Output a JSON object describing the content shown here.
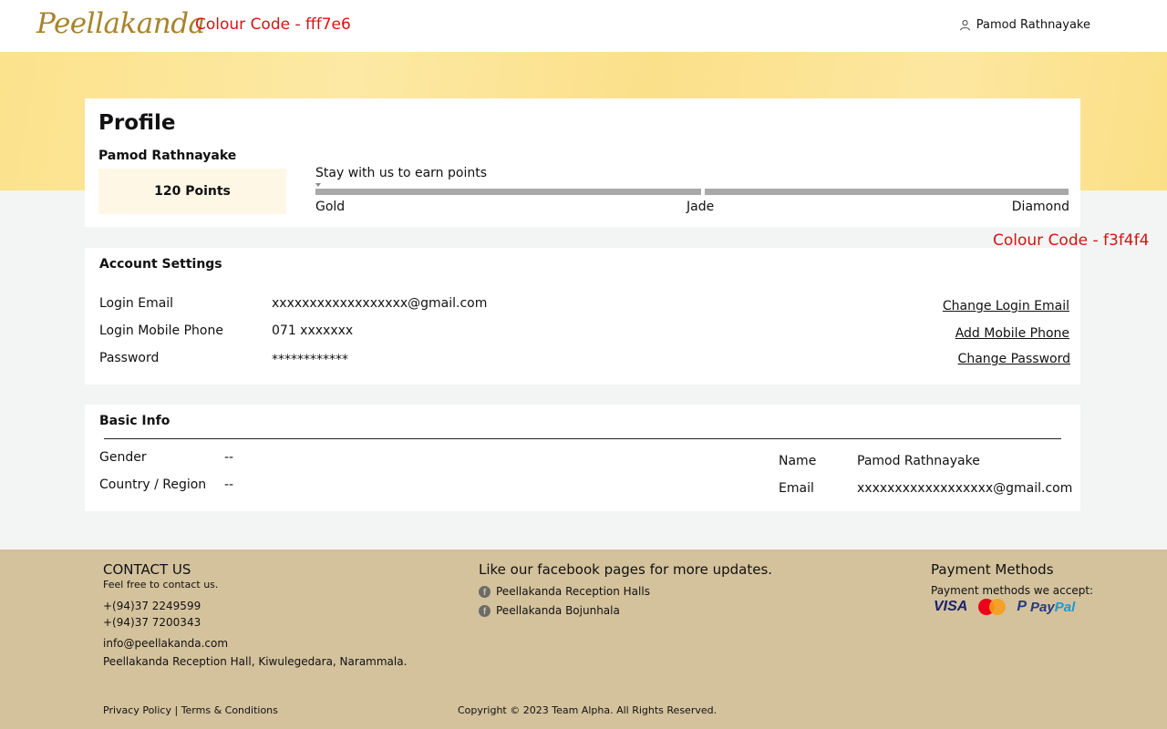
{
  "header": {
    "logo": "Peellakanda",
    "colour_note": "Colour Code - fff7e6",
    "user_name": "Pamod Rathnayake"
  },
  "side_note": "Colour Code - f3f4f4",
  "profile": {
    "title": "Profile",
    "name": "Pamod Rathnayake",
    "points": "120 Points",
    "points_value": 120,
    "earn_label": "Stay with us to earn points",
    "tiers": [
      "Gold",
      "Jade",
      "Diamond"
    ]
  },
  "account_settings": {
    "title": "Account Settings",
    "rows": [
      {
        "label": "Login Email",
        "value": "xxxxxxxxxxxxxxxxxx@gmail.com",
        "action": "Change Login Email"
      },
      {
        "label": "Login Mobile Phone",
        "value": "071 xxxxxxx",
        "action": "Add Mobile Phone"
      },
      {
        "label": "Password",
        "value": "************",
        "action": "Change Password"
      }
    ]
  },
  "basic_info": {
    "title": "Basic Info",
    "left": [
      {
        "label": "Gender",
        "value": "--"
      },
      {
        "label": "Country / Region",
        "value": "--"
      }
    ],
    "right": [
      {
        "label": "Name",
        "value": "Pamod Rathnayake"
      },
      {
        "label": "Email",
        "value": "xxxxxxxxxxxxxxxxxx@gmail.com"
      }
    ]
  },
  "footer": {
    "contact": {
      "heading": "CONTACT US",
      "subtitle": "Feel free to contact us.",
      "phone1": "+(94)37 2249599",
      "phone2": "+(94)37 7200343",
      "email": "info@peellakanda.com",
      "address": "Peellakanda Reception Hall, Kiwulegedara, Narammala."
    },
    "facebook": {
      "heading": "Like our facebook pages for more updates.",
      "pages": [
        "Peellakanda Reception Halls",
        "Peellakanda Bojunhala"
      ]
    },
    "payment": {
      "heading": "Payment Methods",
      "subtitle": "Payment methods we accept:",
      "visa": "VISA",
      "mastercard": "MasterCard",
      "paypal_pay": "Pay",
      "paypal_pal": "Pal"
    },
    "legal": {
      "privacy": "Privacy Policy",
      "separator": "|",
      "terms": "Terms & Conditions",
      "copyright": "Copyright © 2023 Team Alpha. All Rights Reserved."
    }
  },
  "colors": {
    "points_box": "#fff7e6",
    "page_background": "#f3f4f4",
    "footer": "#d4c29d",
    "note_text": "#d31414"
  }
}
